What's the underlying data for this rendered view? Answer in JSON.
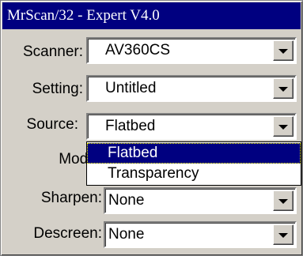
{
  "window": {
    "title": "MrScan/32 - Expert V4.0"
  },
  "fields": {
    "scanner": {
      "label": "Scanner:",
      "value": "AV360CS"
    },
    "setting": {
      "label": "Setting:",
      "value": "Untitled"
    },
    "source": {
      "label": "Source:",
      "value": "Flatbed"
    },
    "mode": {
      "label": "Mode:"
    },
    "sharpen": {
      "label": "Sharpen:",
      "value": "None"
    },
    "descreen": {
      "label": "Descreen:",
      "value": "None"
    }
  },
  "source_dropdown": {
    "options": [
      {
        "label": "Flatbed",
        "selected": true
      },
      {
        "label": "Transparency",
        "selected": false
      }
    ]
  },
  "colors": {
    "titlebar": "#000080",
    "face": "#d4d0c8",
    "selection": "#000080"
  },
  "icons": {
    "dropdown": "chevron-down-icon"
  }
}
